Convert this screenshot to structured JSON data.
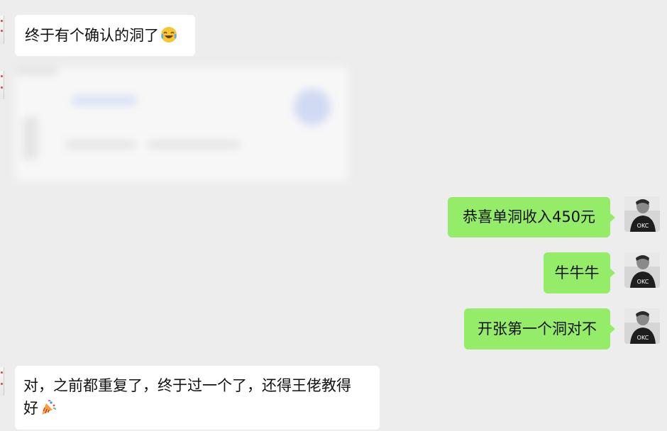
{
  "messages": [
    {
      "side": "left",
      "text": "终于有个确认的洞了",
      "emoji": "laughing-tears-emoji"
    },
    {
      "side": "left",
      "type": "blurred-card"
    },
    {
      "side": "right",
      "text": "恭喜单洞收入450元"
    },
    {
      "side": "right",
      "text": "牛牛牛"
    },
    {
      "side": "right",
      "text": "开张第一个洞对不"
    },
    {
      "side": "left",
      "line1": "对，之前都重复了，终于过一个了，还得王佬教得",
      "line2": "好",
      "emoji": "party-popper-emoji"
    }
  ],
  "avatar_text": "OKC",
  "colors": {
    "background": "#ededed",
    "incoming_bubble": "#ffffff",
    "outgoing_bubble": "#95ec69",
    "text": "#111111"
  }
}
